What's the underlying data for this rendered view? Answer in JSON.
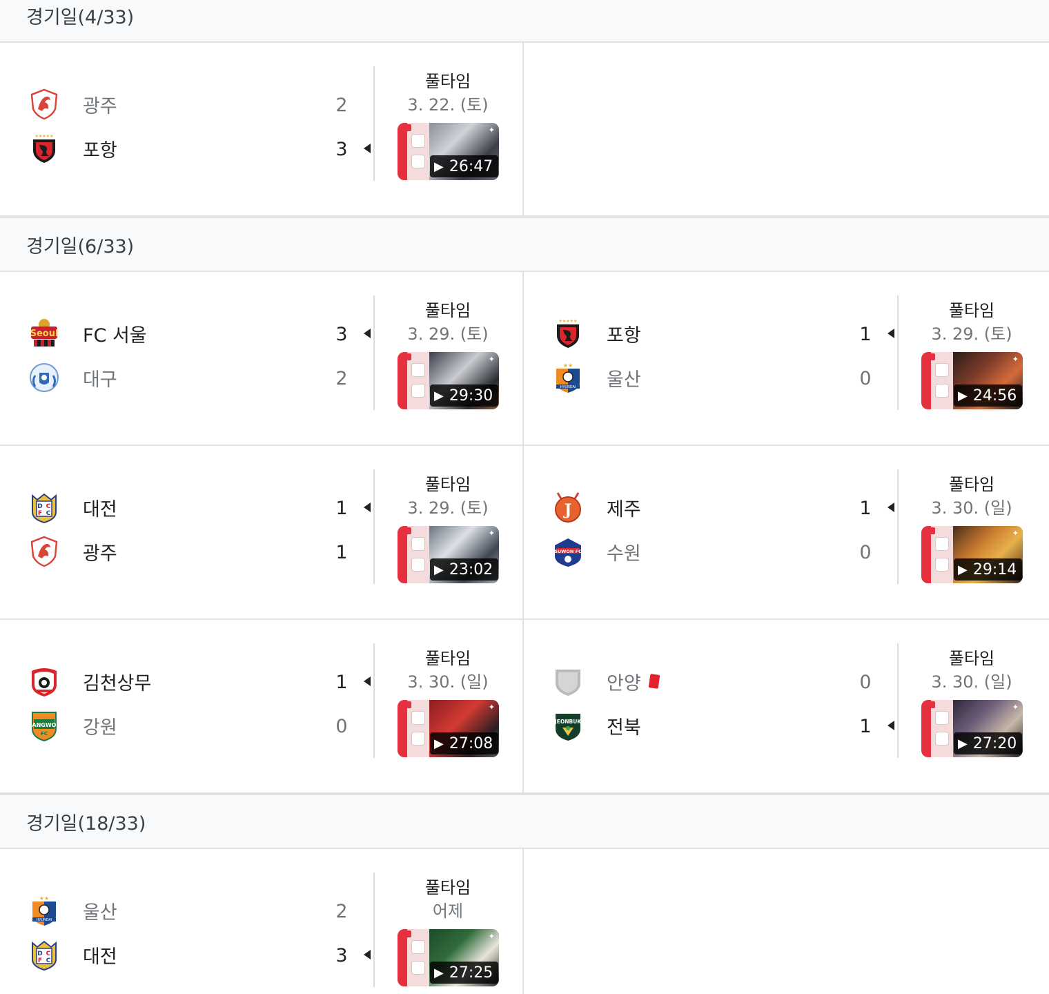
{
  "matchdays": [
    {
      "header": "경기일(4/33)",
      "rows": [
        [
          {
            "home": {
              "name": "광주",
              "score": "2",
              "logo": "gwangju-logo-icon",
              "winner": false
            },
            "away": {
              "name": "포항",
              "score": "3",
              "logo": "pohang-logo-icon",
              "winner": true
            },
            "status": "풀타임",
            "date": "3. 22. (토)",
            "video_duration": "26:47"
          },
          null
        ]
      ]
    },
    {
      "header": "경기일(6/33)",
      "rows": [
        [
          {
            "home": {
              "name": "FC 서울",
              "score": "3",
              "logo": "fc-seoul-logo-icon",
              "winner": true
            },
            "away": {
              "name": "대구",
              "score": "2",
              "logo": "daegu-logo-icon",
              "winner": false
            },
            "status": "풀타임",
            "date": "3. 29. (토)",
            "video_duration": "29:30"
          },
          {
            "home": {
              "name": "포항",
              "score": "1",
              "logo": "pohang-logo-icon",
              "winner": true
            },
            "away": {
              "name": "울산",
              "score": "0",
              "logo": "ulsan-logo-icon",
              "winner": false
            },
            "status": "풀타임",
            "date": "3. 29. (토)",
            "video_duration": "24:56"
          }
        ],
        [
          {
            "home": {
              "name": "대전",
              "score": "1",
              "logo": "daejeon-logo-icon",
              "winner": true
            },
            "away": {
              "name": "광주",
              "score": "1",
              "logo": "gwangju-logo-icon",
              "winner": true
            },
            "status": "풀타임",
            "date": "3. 29. (토)",
            "video_duration": "23:02"
          },
          {
            "home": {
              "name": "제주",
              "score": "1",
              "logo": "jeju-logo-icon",
              "winner": true
            },
            "away": {
              "name": "수원",
              "score": "0",
              "logo": "suwon-logo-icon",
              "winner": false
            },
            "status": "풀타임",
            "date": "3. 30. (일)",
            "video_duration": "29:14"
          }
        ],
        [
          {
            "home": {
              "name": "김천상무",
              "score": "1",
              "logo": "gimcheon-logo-icon",
              "winner": true
            },
            "away": {
              "name": "강원",
              "score": "0",
              "logo": "gangwon-logo-icon",
              "winner": false
            },
            "status": "풀타임",
            "date": "3. 30. (일)",
            "video_duration": "27:08"
          },
          {
            "home": {
              "name": "안양",
              "score": "0",
              "logo": "anyang-logo-icon",
              "winner": false,
              "red_card": true
            },
            "away": {
              "name": "전북",
              "score": "1",
              "logo": "jeonbuk-logo-icon",
              "winner": true
            },
            "status": "풀타임",
            "date": "3. 30. (일)",
            "video_duration": "27:20"
          }
        ]
      ]
    },
    {
      "header": "경기일(18/33)",
      "rows": [
        [
          {
            "home": {
              "name": "울산",
              "score": "2",
              "logo": "ulsan-logo-icon",
              "winner": false
            },
            "away": {
              "name": "대전",
              "score": "3",
              "logo": "daejeon-logo-icon",
              "winner": true
            },
            "status": "풀타임",
            "date": "어제",
            "video_duration": "27:25"
          },
          null
        ]
      ]
    }
  ],
  "colors": {
    "header_bg": "#f8f9fa",
    "divider": "#e0e2e5",
    "text_primary": "#202124",
    "text_secondary": "#70757a",
    "red_card": "#e5202e",
    "highlight_red": "#e5313f"
  },
  "icons": {
    "winner_marker": "triangle-left-icon",
    "play": "play-icon"
  }
}
